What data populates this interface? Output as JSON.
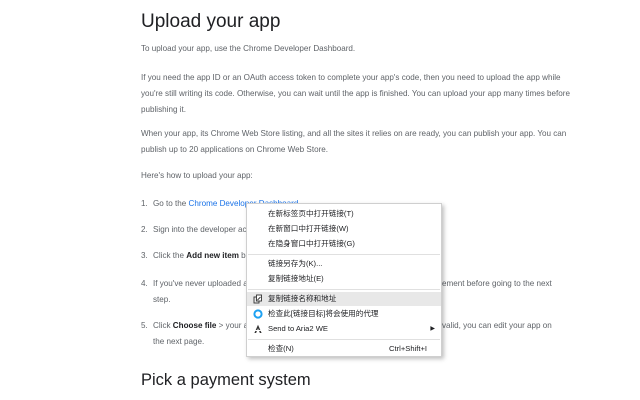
{
  "article": {
    "heading_upload": "Upload your app",
    "p1": "To upload your app, use the Chrome Developer Dashboard.",
    "p2": "If you need the app ID or an OAuth access token to complete your app's code, then you need to upload the app while you're still writing its code. Otherwise, you can wait until the app is finished. You can upload your app many times before publishing it.",
    "p3": "When your app, its Chrome Web Store listing, and all the sites it relies on are ready, you can publish your app. You can publish up to 20 applications on Chrome Web Store.",
    "p4": "Here's how to upload your app:",
    "steps": [
      {
        "num": "1.",
        "pre": "Go to the ",
        "link": "Chrome Developer Dashboard"
      },
      {
        "num": "2.",
        "text": "Sign into the developer ac"
      },
      {
        "num": "3.",
        "pre": "Click the ",
        "bold": "Add new item",
        "post": " b"
      },
      {
        "num": "4.",
        "text": "If you've never uploaded a",
        "tail": "ement before going to the next",
        "cont": "step."
      },
      {
        "num": "5.",
        "pre": "Click ",
        "bold": "Choose file",
        "post": " > your a",
        "tail": "valid, you can edit your app on",
        "cont": "the next page."
      }
    ],
    "heading_payment": "Pick a payment system"
  },
  "context_menu": {
    "items": [
      {
        "label": "在新标签页中打开链接(T)"
      },
      {
        "label": "在新窗口中打开链接(W)"
      },
      {
        "label": "在隐身窗口中打开链接(G)"
      },
      {
        "label": "链接另存为(K)..."
      },
      {
        "label": "复制链接地址(E)"
      },
      {
        "label": "复制链接名称和地址",
        "icon": "copy-link-icon",
        "highlighted": true
      },
      {
        "label": "检查此[链接目标]将会使用的代理",
        "icon": "proxy-circle-icon"
      },
      {
        "label": "Send to Aria2 WE",
        "icon": "aria2-icon",
        "submenu": true
      },
      {
        "label": "检查(N)",
        "shortcut": "Ctrl+Shift+I"
      }
    ]
  },
  "colors": {
    "link": "#1a73e8",
    "proxy_icon": "#1da1f2",
    "highlight": "#e8e8e8"
  }
}
